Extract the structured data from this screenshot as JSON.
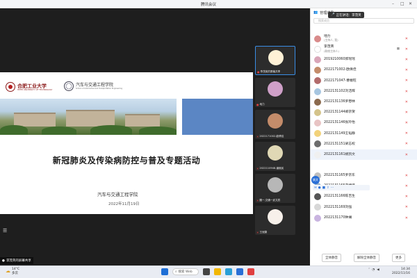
{
  "window": {
    "title": "腾讯会议"
  },
  "panel": {
    "tab_label": "管理成员",
    "speaking": "正在讲话：李茂英",
    "search_placeholder": "搜索成员",
    "members": [
      {
        "name": "地力",
        "sub": "(主持人, 我)",
        "color": "#d98b8b"
      },
      {
        "name": "李茂英",
        "sub": "(联席主持人)",
        "color": "#ffffff"
      },
      {
        "name": "2019210060郭瑶瑶",
        "sub": "",
        "color": "#d9a6b8"
      },
      {
        "name": "2022171002-欧倩佳",
        "sub": "",
        "color": "#c48c6a"
      },
      {
        "name": "2022171047-曹幄旺",
        "sub": "",
        "color": "#b26b6b"
      },
      {
        "name": "2022131102刘洁辉",
        "sub": "",
        "color": "#a7c6e0"
      },
      {
        "name": "2022131136罗懋林",
        "sub": "",
        "color": "#8b6a4e"
      },
      {
        "name": "2022131144郑宗贺",
        "sub": "",
        "color": "#d4c38a"
      },
      {
        "name": "2022131146张玲怡",
        "sub": "",
        "color": "#e8c4c4"
      },
      {
        "name": "2022131149王韬静",
        "sub": "",
        "color": "#f2d27a"
      },
      {
        "name": "2022131151梁志权",
        "sub": "",
        "color": "#6d6d6d"
      },
      {
        "name": "2022131161姚凯文",
        "sub": "",
        "color": "#f0f0f0"
      },
      {
        "name": "2022131165罗宗东",
        "sub": "",
        "color": "#bfbfbf"
      },
      {
        "name": "2022131165游博伟",
        "sub": "",
        "color": "#9bb3c9"
      },
      {
        "name": "2022131166陈吉生",
        "sub": "",
        "color": "#555555"
      },
      {
        "name": "2022131169刘强",
        "sub": "",
        "color": "#d7d7d7"
      },
      {
        "name": "2022131170钟斓",
        "sub": "",
        "color": "#c9b4e0"
      }
    ],
    "hover_badge": "姚文",
    "footer": {
      "mute_all": "全体静音",
      "unmute_all": "解除全体静音",
      "more": "更多"
    }
  },
  "slide": {
    "logo_a_cn": "合肥工业大学",
    "logo_a_en": "HEFEI UNIVERSITY OF TECHNOLOGY",
    "logo_b_cn": "汽车与交通工程学院",
    "logo_b_en": "School of Automotive and Transportation Engineering",
    "title": "新冠肺炎及传染病防控与普及专题活动",
    "subtitle": "汽车与交通工程学院",
    "date": "2022年11月19日"
  },
  "share_label": "李茂英的屏幕共享",
  "videos": [
    {
      "label": "李茂英的屏幕共享",
      "color": "#fff1d6",
      "active": true
    },
    {
      "label": "地力",
      "color": "#cfa0c8",
      "active": false
    },
    {
      "label": "2022171002-欧倩佳",
      "color": "#c48c6a",
      "active": false
    },
    {
      "label": "2022110948-潘赋民",
      "color": "#e0d8b5",
      "active": false
    },
    {
      "label": "圆一,交通一武文辰",
      "color": "#b7b7b7",
      "active": false
    },
    {
      "label": "王冠婕",
      "color": "#f7f0ea",
      "active": false
    }
  ],
  "taskbar": {
    "weather_temp": "14°C",
    "weather_desc": "多云",
    "search": "搜索 Web",
    "time": "14:34",
    "date": "2022/11/16"
  }
}
